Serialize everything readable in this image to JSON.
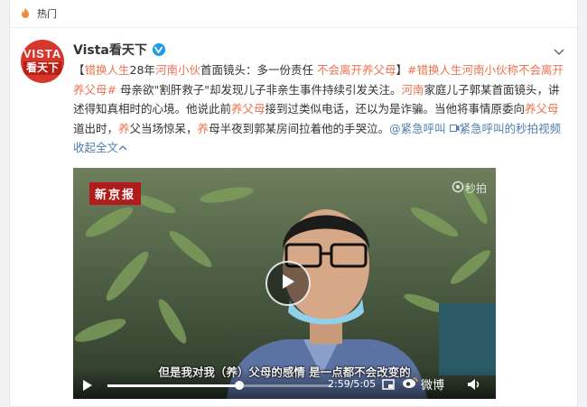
{
  "topbar": {
    "label": "热门"
  },
  "user": {
    "name": "Vista看天下",
    "avatar_line1": "VISTA",
    "avatar_line2": "看天下"
  },
  "post": {
    "seg1": "【",
    "seg2": "错换人生",
    "seg3": "28年",
    "seg4": "河南小伙",
    "seg5": "首面镜头：多一份责任 ",
    "seg6": "不会离开养父母",
    "seg7": "】",
    "seg8": "#错换人生河南小伙称不会离开养父母#",
    "seg9": " 母亲欲\"割肝救子\"却发现儿子非亲生事件持续引发关注。",
    "seg10": "河南",
    "seg11": "家庭儿子郭某首面镜头，讲述得知真相时的心境。他说此前",
    "seg12": "养父母",
    "seg13": "接到过类似电话，还以为是诈骗。当他将事情原委向",
    "seg14": "养父母",
    "seg15": "道出时，",
    "seg16": "养",
    "seg17": "父当场惊呆，",
    "seg18": "养",
    "seg19": "母半夜到郭某房间拉着他的手哭泣。",
    "mention": "@紧急呼叫",
    "video_link": "紧急呼叫的秒拍视频",
    "collapse": "收起全文"
  },
  "video": {
    "news_badge": "新京报",
    "watermark": "秒拍",
    "subtitle": "但是我对我（养）父母的感情 是一点都不会改变的",
    "time": "2:59/5:05",
    "progress": 0.59,
    "brand": "微博"
  },
  "colors": {
    "link": "#eb7350",
    "blue": "#507daf",
    "news": "#b01c1c"
  }
}
